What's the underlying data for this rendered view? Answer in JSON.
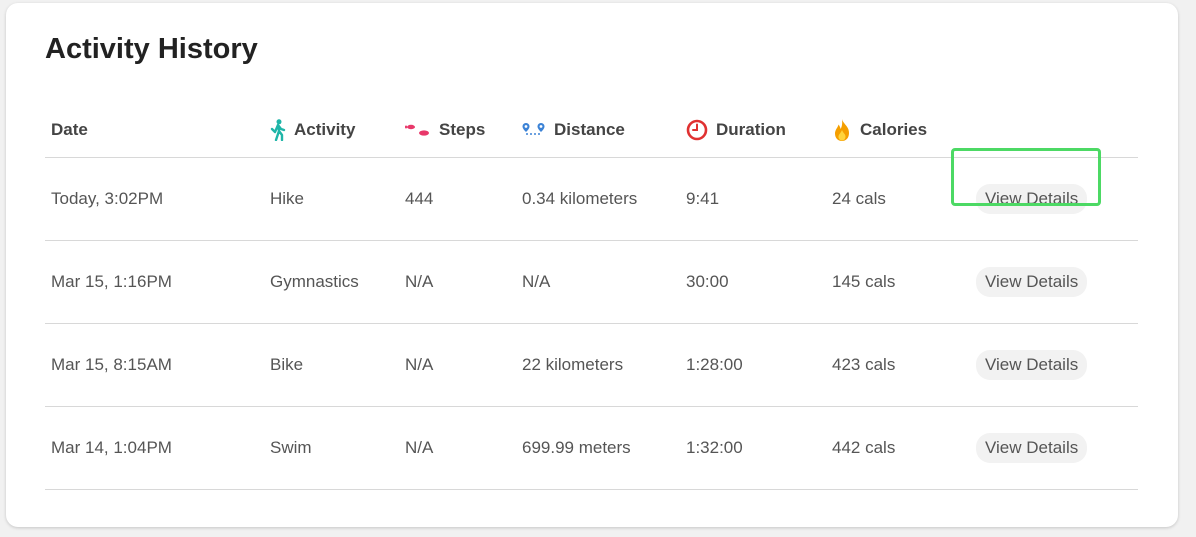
{
  "page": {
    "title": "Activity History"
  },
  "table": {
    "headers": {
      "date": "Date",
      "activity": "Activity",
      "steps": "Steps",
      "distance": "Distance",
      "duration": "Duration",
      "calories": "Calories"
    },
    "header_icons": {
      "activity": "person-walking-icon",
      "steps": "footprints-icon",
      "distance": "route-icon",
      "duration": "clock-icon",
      "calories": "fire-icon"
    },
    "rows": [
      {
        "date": "Today, 3:02PM",
        "activity": "Hike",
        "steps": "444",
        "distance": "0.34 kilometers",
        "duration": "9:41",
        "calories": "24 cals",
        "action": "View Details"
      },
      {
        "date": "Mar 15, 1:16PM",
        "activity": "Gymnastics",
        "steps": "N/A",
        "distance": "N/A",
        "duration": "30:00",
        "calories": "145 cals",
        "action": "View Details"
      },
      {
        "date": "Mar 15, 8:15AM",
        "activity": "Bike",
        "steps": "N/A",
        "distance": "22 kilometers",
        "duration": "1:28:00",
        "calories": "423 cals",
        "action": "View Details"
      },
      {
        "date": "Mar 14, 1:04PM",
        "activity": "Swim",
        "steps": "N/A",
        "distance": "699.99 meters",
        "duration": "1:32:00",
        "calories": "442 cals",
        "action": "View Details"
      }
    ]
  },
  "colors": {
    "highlight": "#4cd964",
    "activity_icon": "#1fb5a8",
    "steps_icon": "#e8386a",
    "distance_icon": "#3b82d6",
    "duration_icon": "#e03131",
    "calories_icon": "#f59f00"
  }
}
